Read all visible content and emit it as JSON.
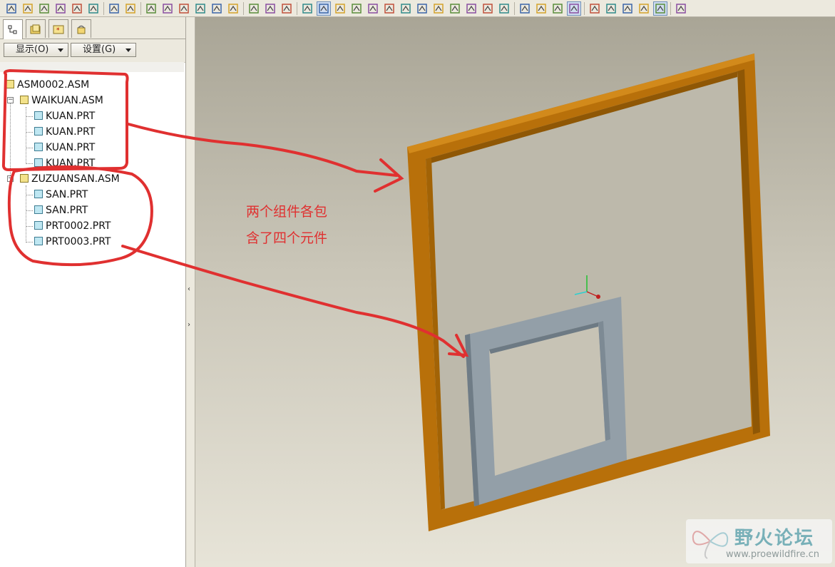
{
  "left_panel": {
    "show_button": "显示(O)",
    "settings_button": "设置(G)"
  },
  "tree": {
    "root": "ASM0002.ASM",
    "asm1": {
      "label": "WAIKUAN.ASM",
      "parts": [
        "KUAN.PRT",
        "KUAN.PRT",
        "KUAN.PRT",
        "KUAN.PRT"
      ]
    },
    "asm2": {
      "label": "ZUZUANSAN.ASM",
      "parts": [
        "SAN.PRT",
        "SAN.PRT",
        "PRT0002.PRT",
        "PRT0003.PRT"
      ]
    }
  },
  "annotation": {
    "line1": "两个组件各包",
    "line2": "含了四个元件",
    "color": "#e03030"
  },
  "watermark": {
    "title": "野火论坛",
    "url": "www.proewildfire.cn"
  },
  "colors": {
    "frame_outer": "#b8700a",
    "frame_inner": "#939fa8",
    "annotation_red": "#e03030"
  },
  "toolbar_icons": [
    "new-icon",
    "open-icon",
    "save-icon",
    "print-icon",
    "preview-icon",
    "print2-icon",
    "undo-icon",
    "redo-icon",
    "cut-icon",
    "copy-icon",
    "paste-icon",
    "paste-special-icon",
    "regenerate-icon",
    "regen-manager-icon",
    "find-icon",
    "select-box-icon",
    "dropdown-icon",
    "repaint-icon",
    "spin-center-icon",
    "orient-icon",
    "pan-icon",
    "zoom-in-icon",
    "zoom-out-icon",
    "refit-icon",
    "reorient-icon",
    "saved-views-icon",
    "layers-icon",
    "appearance-icon",
    "view-manager-icon",
    "render-icon",
    "wireframe-icon",
    "hidden-line-icon",
    "no-hidden-icon",
    "shaded-icon",
    "datum-planes-icon",
    "datum-axes-icon",
    "datum-points-icon",
    "csys-icon",
    "annotation-display-icon",
    "whats-this-icon"
  ]
}
